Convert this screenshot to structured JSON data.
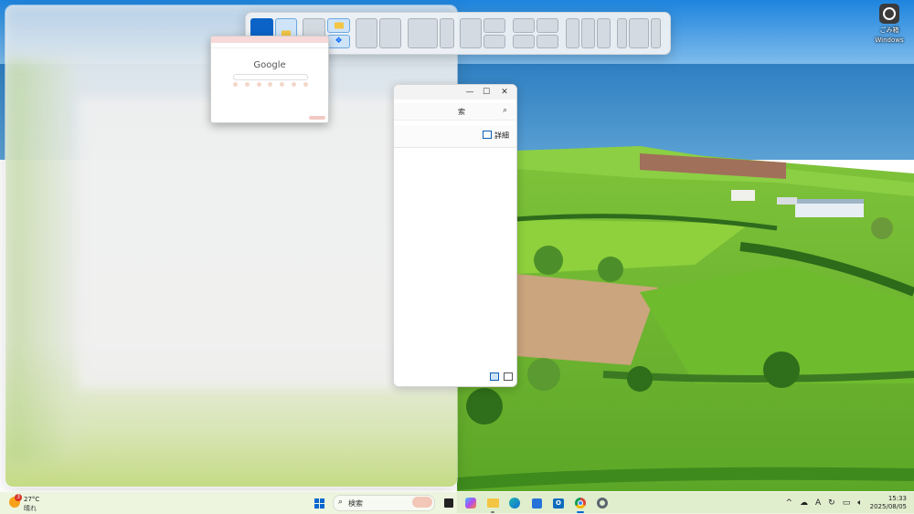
{
  "desktop": {
    "icon_label": "ごみ箱",
    "icon_label_line2": "Windows"
  },
  "snap_flyout": {
    "layouts": [
      "half-half",
      "two-thirds-one-third",
      "thirds",
      "quarters",
      "wide-center-thirds"
    ]
  },
  "chrome_thumbnail": {
    "logo_text": "Google"
  },
  "explorer": {
    "address_text": "索",
    "details_label": "詳細"
  },
  "taskbar": {
    "weather": {
      "temp": "27°C",
      "condition": "晴れ",
      "badge": "3"
    },
    "search_placeholder": "検索",
    "outlook_letter": "O",
    "clock": {
      "time": "15:33",
      "date": "2025/08/05"
    },
    "tray_ime": "A"
  }
}
